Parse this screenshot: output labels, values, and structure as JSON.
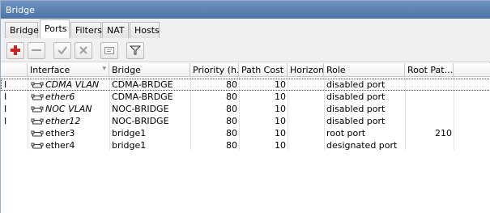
{
  "window": {
    "title": "Bridge"
  },
  "tabs": [
    {
      "label": "Bridge",
      "active": false
    },
    {
      "label": "Ports",
      "active": true
    },
    {
      "label": "Filters",
      "active": false
    },
    {
      "label": "NAT",
      "active": false
    },
    {
      "label": "Hosts",
      "active": false
    }
  ],
  "toolbar": {
    "add_icon": "plus-icon",
    "remove_icon": "minus-icon",
    "enable_icon": "check-icon",
    "disable_icon": "x-icon",
    "comment_icon": "note-icon",
    "filter_icon": "funnel-icon"
  },
  "table": {
    "columns": [
      "Interface",
      "Bridge",
      "Priority (h...",
      "Path Cost",
      "Horizon",
      "Role",
      "Root Pat..."
    ],
    "rows": [
      {
        "flag": "I",
        "interface": "CDMA VLAN",
        "bridge": "CDMA-BRDGE",
        "priority": "80",
        "path_cost": "10",
        "horizon": "",
        "role": "disabled port",
        "root_path": "",
        "inactive": true,
        "selected": true
      },
      {
        "flag": "I",
        "interface": "ether6",
        "bridge": "CDMA-BRDGE",
        "priority": "80",
        "path_cost": "10",
        "horizon": "",
        "role": "disabled port",
        "root_path": "",
        "inactive": true,
        "selected": false
      },
      {
        "flag": "I",
        "interface": "NOC VLAN",
        "bridge": "NOC-BRIDGE",
        "priority": "80",
        "path_cost": "10",
        "horizon": "",
        "role": "disabled port",
        "root_path": "",
        "inactive": true,
        "selected": false
      },
      {
        "flag": "I",
        "interface": "ether12",
        "bridge": "NOC-BRIDGE",
        "priority": "80",
        "path_cost": "10",
        "horizon": "",
        "role": "disabled port",
        "root_path": "",
        "inactive": true,
        "selected": false
      },
      {
        "flag": "",
        "interface": "ether3",
        "bridge": "bridge1",
        "priority": "80",
        "path_cost": "10",
        "horizon": "",
        "role": "root port",
        "root_path": "210",
        "inactive": false,
        "selected": false
      },
      {
        "flag": "",
        "interface": "ether4",
        "bridge": "bridge1",
        "priority": "80",
        "path_cost": "10",
        "horizon": "",
        "role": "designated port",
        "root_path": "",
        "inactive": false,
        "selected": false
      }
    ]
  }
}
